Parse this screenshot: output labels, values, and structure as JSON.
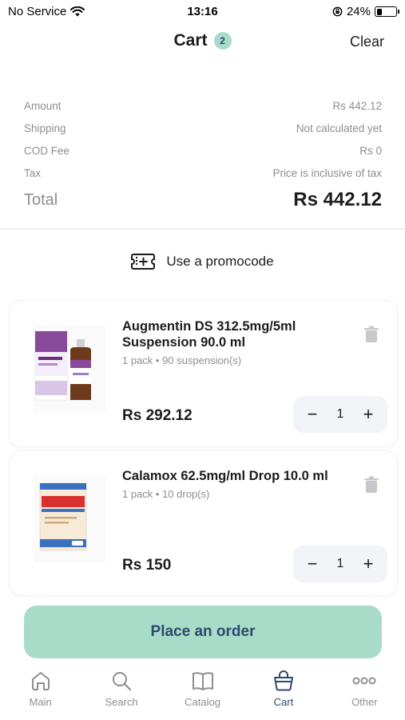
{
  "status": {
    "carrier": "No Service",
    "time": "13:16",
    "battery": "24%",
    "battery_level": 0.24
  },
  "header": {
    "title": "Cart",
    "badge_count": "2",
    "clear_label": "Clear"
  },
  "summary": {
    "rows": [
      {
        "label": "Amount",
        "value": "Rs 442.12"
      },
      {
        "label": "Shipping",
        "value": "Not calculated yet"
      },
      {
        "label": "COD Fee",
        "value": "Rs 0"
      },
      {
        "label": "Tax",
        "value": "Price is inclusive of tax"
      }
    ],
    "total_label": "Total",
    "total_value": "Rs 442.12"
  },
  "promo": {
    "label": "Use a promocode"
  },
  "items": [
    {
      "name": "Augmentin DS 312.5mg/5ml Suspension 90.0 ml",
      "sub": "1 pack • 90 suspension(s)",
      "price": "Rs 292.12",
      "qty": "1",
      "minus": "−",
      "plus": "+"
    },
    {
      "name": "Calamox 62.5mg/ml Drop 10.0 ml",
      "sub": "1 pack • 10 drop(s)",
      "price": "Rs 150",
      "qty": "1",
      "minus": "−",
      "plus": "+"
    }
  ],
  "order_button": {
    "label": "Place an order"
  },
  "tabs": [
    {
      "label": "Main",
      "icon": "home-icon"
    },
    {
      "label": "Search",
      "icon": "search-icon"
    },
    {
      "label": "Catalog",
      "icon": "book-icon"
    },
    {
      "label": "Cart",
      "icon": "cart-icon",
      "active": true
    },
    {
      "label": "Other",
      "icon": "more-icon"
    }
  ],
  "colors": {
    "accent": "#a8dcc8",
    "accent_text": "#2c4a6e",
    "muted": "#8e8e93"
  }
}
